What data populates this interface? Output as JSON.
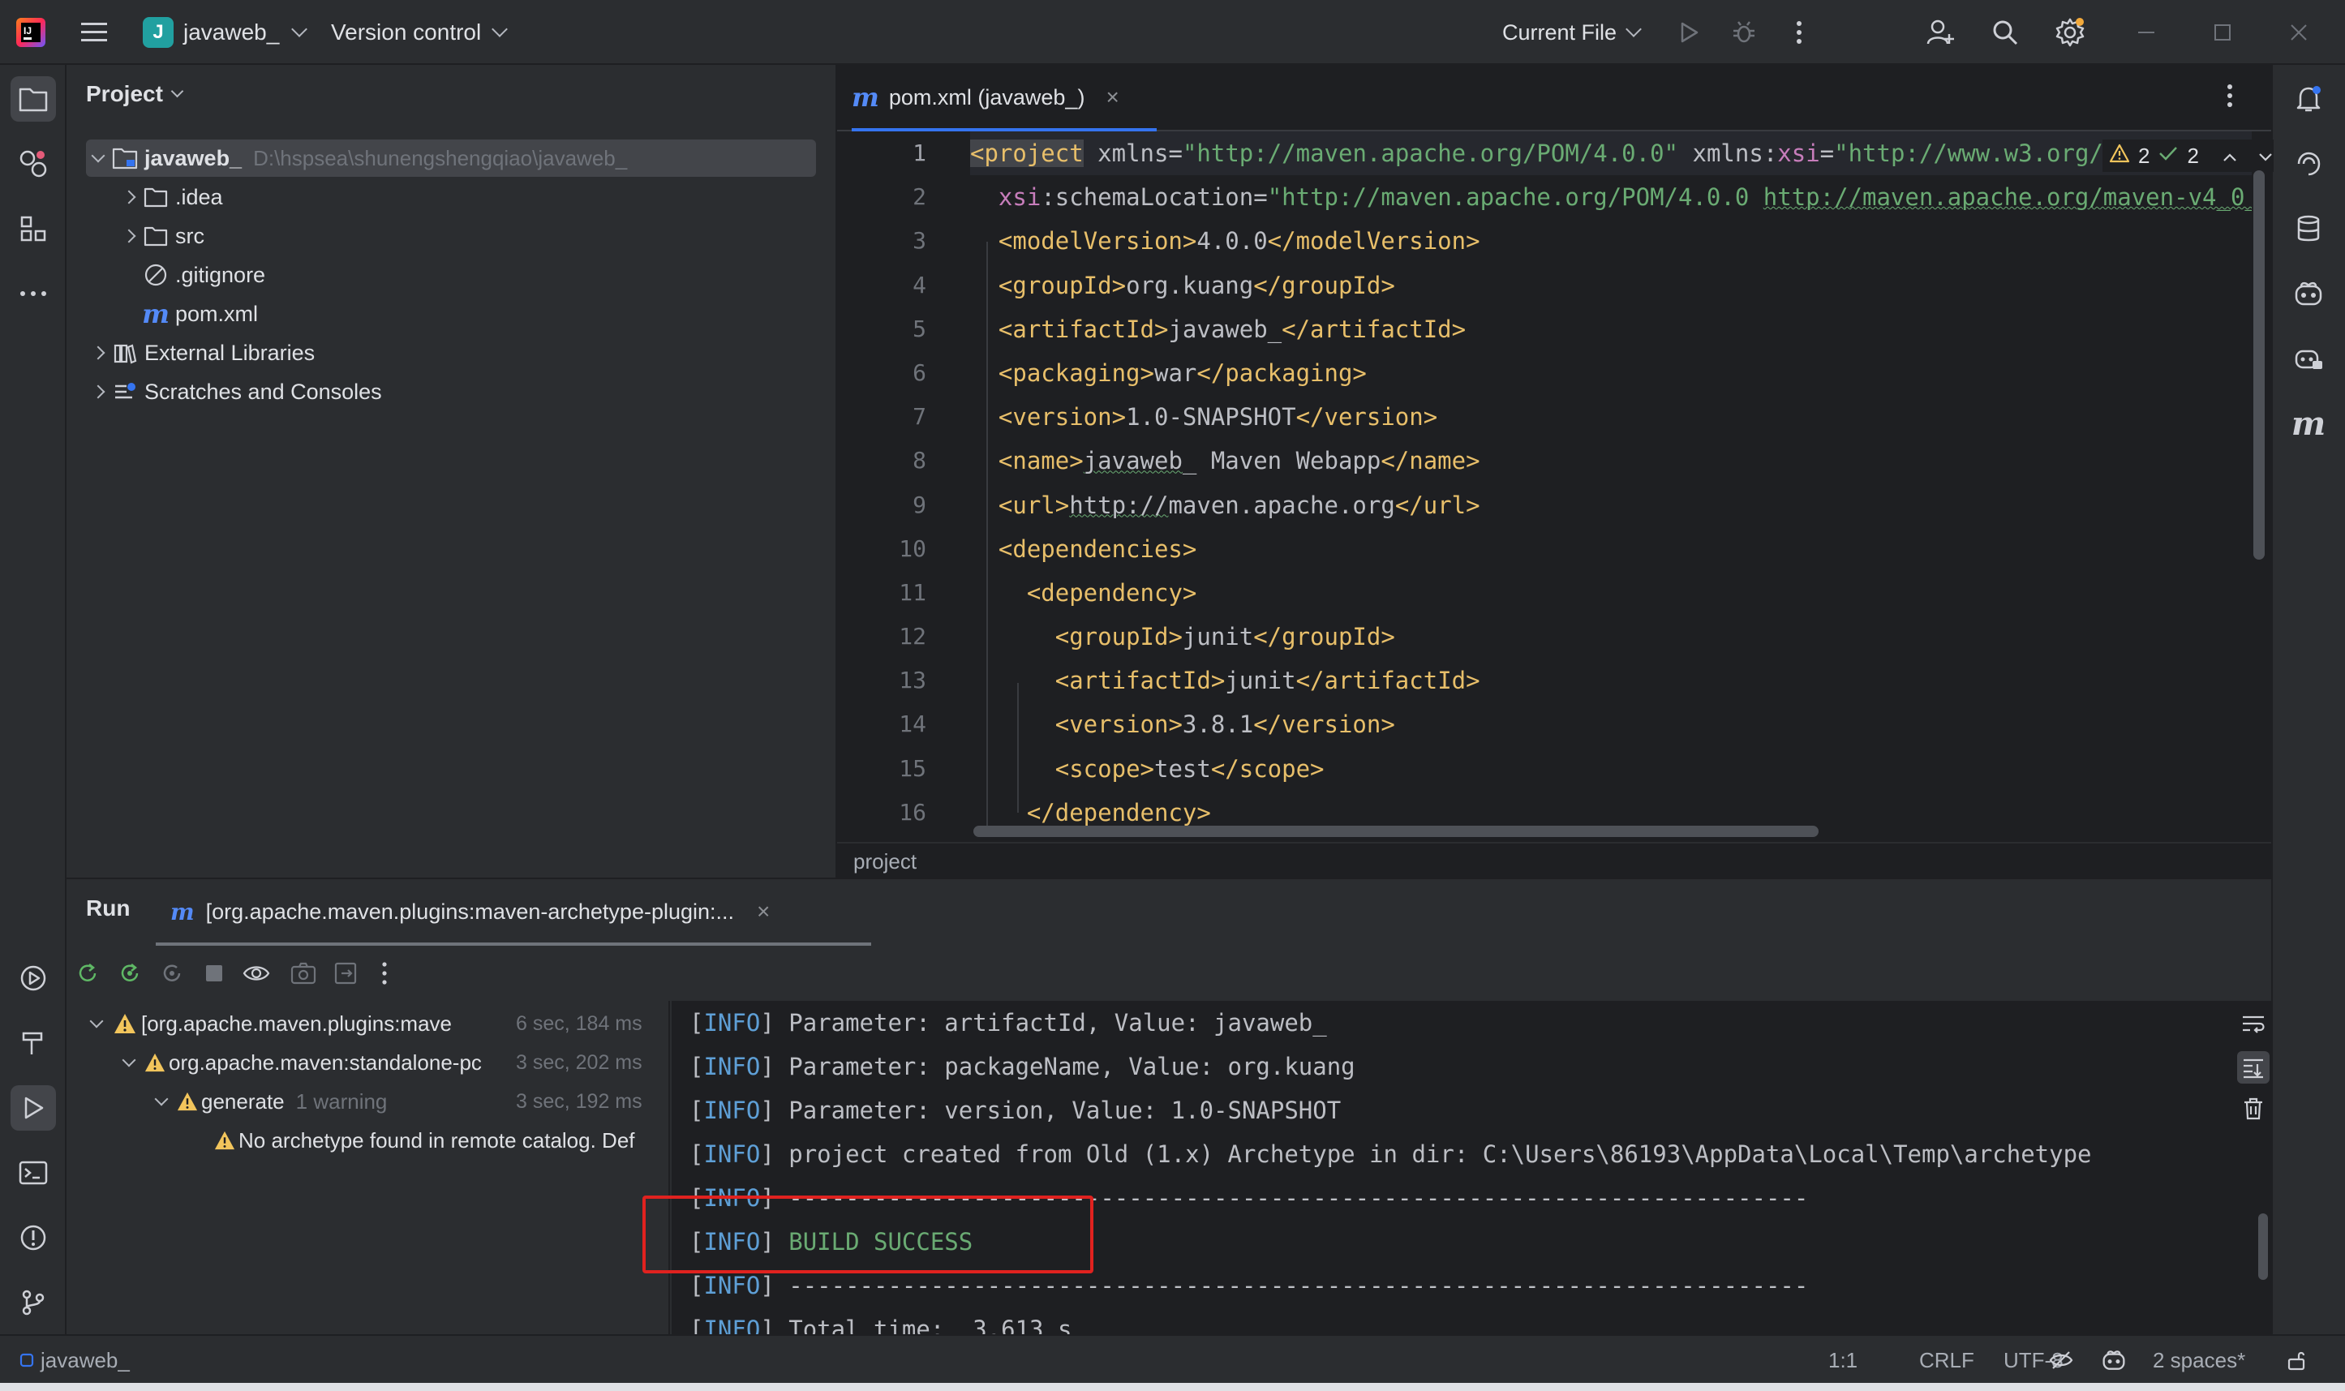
{
  "titlebar": {
    "project_badge": "J",
    "project_name": "javaweb_",
    "vcs_label": "Version control",
    "run_config": "Current File"
  },
  "project_panel": {
    "title": "Project",
    "items": [
      {
        "label": "javaweb_",
        "path": "D:\\hspsea\\shunengshengqiao\\javaweb_"
      },
      {
        "label": ".idea"
      },
      {
        "label": "src"
      },
      {
        "label": ".gitignore"
      },
      {
        "label": "pom.xml"
      },
      {
        "label": "External Libraries"
      },
      {
        "label": "Scratches and Consoles"
      }
    ]
  },
  "editor": {
    "tab_label": "pom.xml (javaweb_)",
    "tab_icon": "m",
    "warnings_count": "2",
    "ok_count": "2",
    "line_numbers": [
      "1",
      "2",
      "3",
      "4",
      "5",
      "6",
      "7",
      "8",
      "9",
      "10",
      "11",
      "12",
      "13",
      "14",
      "15",
      "16"
    ],
    "breadcrumb": "project"
  },
  "run": {
    "title": "Run",
    "tab_label": "[org.apache.maven.plugins:maven-archetype-plugin:...",
    "tree": [
      {
        "label": "[org.apache.maven.plugins:mave",
        "time": "6 sec, 184 ms"
      },
      {
        "label": "org.apache.maven:standalone-pc",
        "time": "3 sec, 202 ms"
      },
      {
        "label": "generate",
        "extra": "1 warning",
        "time": "3 sec, 192 ms"
      },
      {
        "label": "No archetype found in remote catalog. Def"
      }
    ],
    "console": [
      {
        "tag": "INFO",
        "text": " Parameter: artifactId, Value: javaweb_"
      },
      {
        "tag": "INFO",
        "text": " Parameter: packageName, Value: org.kuang"
      },
      {
        "tag": "INFO",
        "text": " Parameter: version, Value: 1.0-SNAPSHOT"
      },
      {
        "tag": "INFO",
        "text": " project created from Old (1.x) Archetype in dir: C:\\Users\\86193\\AppData\\Local\\Temp\\archetype"
      },
      {
        "tag": "INFO",
        "text": " ------------------------------------------------------------------------"
      },
      {
        "tag": "INFO",
        "text": " BUILD SUCCESS"
      },
      {
        "tag": "INFO",
        "text": " ------------------------------------------------------------------------"
      },
      {
        "tag": "INFO",
        "text": " Total time:  3.613 s"
      }
    ]
  },
  "statusbar": {
    "project": "javaweb_",
    "position": "1:1",
    "line_sep": "CRLF",
    "encoding": "UTF-8",
    "indent": "2 spaces*"
  }
}
